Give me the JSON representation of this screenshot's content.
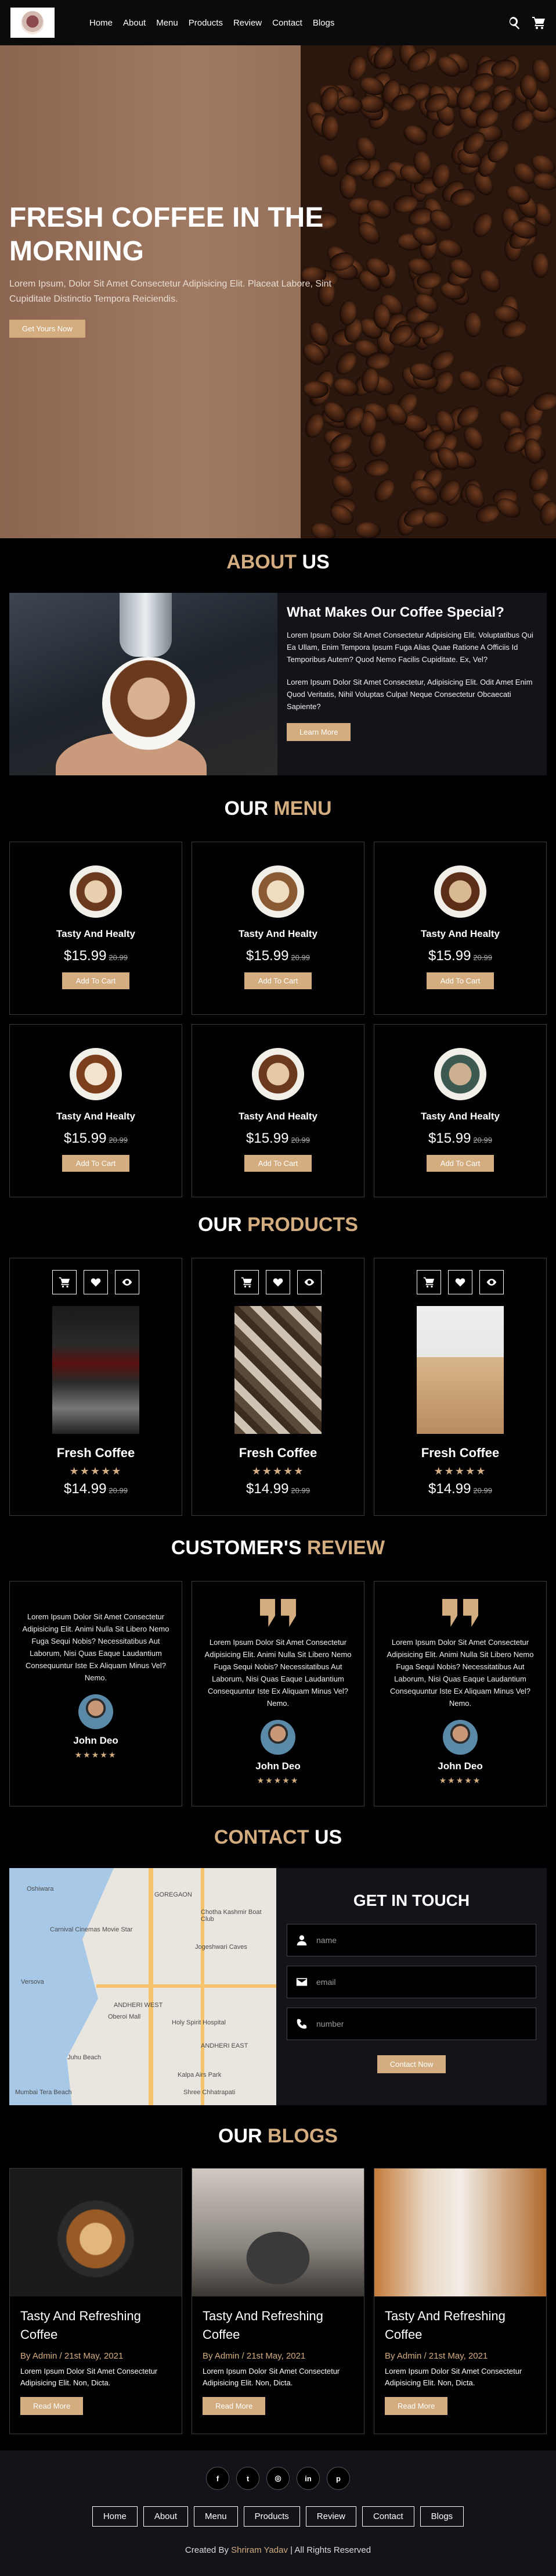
{
  "header": {
    "nav": [
      "Home",
      "About",
      "Menu",
      "Products",
      "Review",
      "Contact",
      "Blogs"
    ],
    "icons": [
      "search-icon",
      "cart-icon"
    ]
  },
  "hero": {
    "title": "FRESH COFFEE IN THE MORNING",
    "text": "Lorem Ipsum, Dolor Sit Amet Consectetur Adipisicing Elit. Placeat Labore, Sint Cupiditate Distinctio Tempora Reiciendis.",
    "button": "Get Yours Now"
  },
  "about": {
    "heading_a": "ABOUT",
    "heading_b": "US",
    "title": "What Makes Our Coffee Special?",
    "p1": "Lorem Ipsum Dolor Sit Amet Consectetur Adipisicing Elit. Voluptatibus Qui Ea Ullam, Enim Tempora Ipsum Fuga Alias Quae Ratione A Officiis Id Temporibus Autem? Quod Nemo Facilis Cupiditate. Ex, Vel?",
    "p2": "Lorem Ipsum Dolor Sit Amet Consectetur, Adipisicing Elit. Odit Amet Enim Quod Veritatis, Nihil Voluptas Culpa! Neque Consectetur Obcaecati Sapiente?",
    "button": "Learn More"
  },
  "menu": {
    "heading_a": "OUR",
    "heading_b": "MENU",
    "items": [
      {
        "name": "Tasty And Healty",
        "price": "$15.99",
        "old": "20.99",
        "button": "Add To Cart"
      },
      {
        "name": "Tasty And Healty",
        "price": "$15.99",
        "old": "20.99",
        "button": "Add To Cart"
      },
      {
        "name": "Tasty And Healty",
        "price": "$15.99",
        "old": "20.99",
        "button": "Add To Cart"
      },
      {
        "name": "Tasty And Healty",
        "price": "$15.99",
        "old": "20.99",
        "button": "Add To Cart"
      },
      {
        "name": "Tasty And Healty",
        "price": "$15.99",
        "old": "20.99",
        "button": "Add To Cart"
      },
      {
        "name": "Tasty And Healty",
        "price": "$15.99",
        "old": "20.99",
        "button": "Add To Cart"
      }
    ]
  },
  "products": {
    "heading_a": "OUR",
    "heading_b": "PRODUCTS",
    "items": [
      {
        "name": "Fresh Coffee",
        "stars": "★★★★★",
        "rating": 4.5,
        "price": "$14.99",
        "old": "20.99"
      },
      {
        "name": "Fresh Coffee",
        "stars": "★★★★★",
        "rating": 4.5,
        "price": "$14.99",
        "old": "20.99"
      },
      {
        "name": "Fresh Coffee",
        "stars": "★★★★★",
        "rating": 4.5,
        "price": "$14.99",
        "old": "20.99"
      }
    ]
  },
  "review": {
    "heading_a": "CUSTOMER'S",
    "heading_b": "REVIEW",
    "items": [
      {
        "text": "Lorem Ipsum Dolor Sit Amet Consectetur Adipisicing Elit. Animi Nulla Sit Libero Nemo Fuga Sequi Nobis? Necessitatibus Aut Laborum, Nisi Quas Eaque Laudantium Consequuntur Iste Ex Aliquam Minus Vel? Nemo.",
        "name": "John Deo",
        "stars": "★★★★★",
        "rating": 4.5
      },
      {
        "text": "Lorem Ipsum Dolor Sit Amet Consectetur Adipisicing Elit. Animi Nulla Sit Libero Nemo Fuga Sequi Nobis? Necessitatibus Aut Laborum, Nisi Quas Eaque Laudantium Consequuntur Iste Ex Aliquam Minus Vel? Nemo.",
        "name": "John Deo",
        "stars": "★★★★★",
        "rating": 4.5
      },
      {
        "text": "Lorem Ipsum Dolor Sit Amet Consectetur Adipisicing Elit. Animi Nulla Sit Libero Nemo Fuga Sequi Nobis? Necessitatibus Aut Laborum, Nisi Quas Eaque Laudantium Consequuntur Iste Ex Aliquam Minus Vel? Nemo.",
        "name": "John Deo",
        "stars": "★★★★★",
        "rating": 4.5
      }
    ]
  },
  "contact": {
    "heading_a": "CONTACT",
    "heading_b": "US",
    "title": "GET IN TOUCH",
    "name_placeholder": "name",
    "email_placeholder": "email",
    "number_placeholder": "number",
    "button": "Contact Now",
    "map_labels": [
      "Oshiwara",
      "GOREGAON",
      "Chotha Kashmir Boat Club",
      "Carnival Cinemas Movie Star",
      "Oberoi Mall",
      "ANDHERI WEST",
      "Jogeshwari Caves",
      "Versova",
      "Holy Spirit Hospital",
      "Juhu Beach",
      "ANDHERI EAST",
      "Kalpa Airs Park",
      "Mumbai Tera Beach",
      "Shree Chhatrapati"
    ]
  },
  "blogs": {
    "heading_a": "OUR",
    "heading_b": "BLOGS",
    "items": [
      {
        "title": "Tasty And Refreshing Coffee",
        "meta": "By Admin / 21st May, 2021",
        "text": "Lorem Ipsum Dolor Sit Amet Consectetur Adipisicing Elit. Non, Dicta.",
        "button": "Read More"
      },
      {
        "title": "Tasty And Refreshing Coffee",
        "meta": "By Admin / 21st May, 2021",
        "text": "Lorem Ipsum Dolor Sit Amet Consectetur Adipisicing Elit. Non, Dicta.",
        "button": "Read More"
      },
      {
        "title": "Tasty And Refreshing Coffee",
        "meta": "By Admin / 21st May, 2021",
        "text": "Lorem Ipsum Dolor Sit Amet Consectetur Adipisicing Elit. Non, Dicta.",
        "button": "Read More"
      }
    ]
  },
  "footer": {
    "social": [
      {
        "icon": "facebook-icon",
        "glyph": "f"
      },
      {
        "icon": "twitter-icon",
        "glyph": "t"
      },
      {
        "icon": "instagram-icon",
        "glyph": "◎"
      },
      {
        "icon": "linkedin-icon",
        "glyph": "in"
      },
      {
        "icon": "pinterest-icon",
        "glyph": "p"
      }
    ],
    "links": [
      "Home",
      "About",
      "Menu",
      "Products",
      "Review",
      "Contact",
      "Blogs"
    ],
    "credit_pre": "Created By",
    "credit_name": "Shriram Yadav",
    "credit_post": "| All Rights Reserved"
  },
  "colors": {
    "accent": "#d3ad7f",
    "bg": "#010103",
    "panel": "#13131a"
  }
}
